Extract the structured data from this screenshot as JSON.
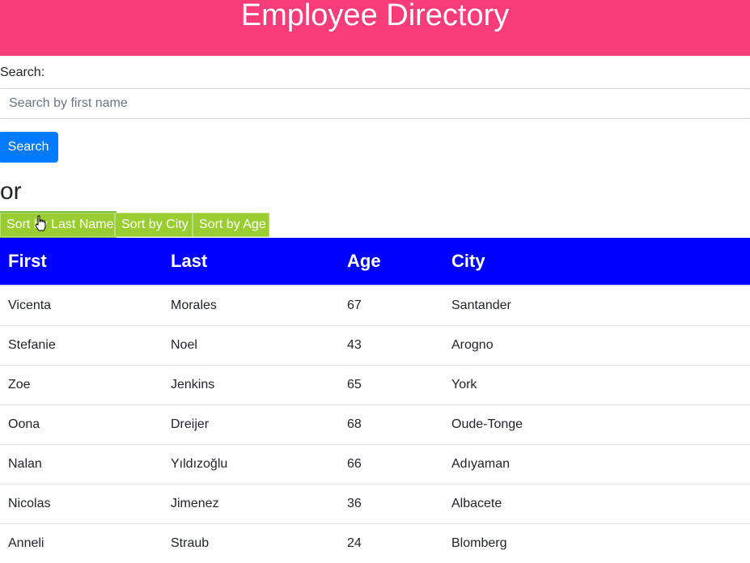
{
  "header": {
    "title": "Employee Directory",
    "bg_color": "#f73c78"
  },
  "search": {
    "label": "Search:",
    "placeholder": "Search by first name",
    "value": "",
    "button_label": "Search"
  },
  "or_text": "or",
  "sort": {
    "last_name_label": "Sort by Last Name",
    "city_label": "Sort by City",
    "age_label": "Sort by Age",
    "button_color": "#9acd32"
  },
  "table": {
    "header_color": "#0000ff",
    "columns": [
      "First",
      "Last",
      "Age",
      "City"
    ],
    "rows": [
      [
        "Vicenta",
        "Morales",
        "67",
        "Santander"
      ],
      [
        "Stefanie",
        "Noel",
        "43",
        "Arogno"
      ],
      [
        "Zoe",
        "Jenkins",
        "65",
        "York"
      ],
      [
        "Oona",
        "Dreijer",
        "68",
        "Oude-Tonge"
      ],
      [
        "Nalan",
        "Yıldızoğlu",
        "66",
        "Adıyaman"
      ],
      [
        "Nicolas",
        "Jimenez",
        "36",
        "Albacete"
      ],
      [
        "Anneli",
        "Straub",
        "24",
        "Blomberg"
      ]
    ]
  },
  "icons": {
    "cursor": "hand-pointer-icon"
  }
}
